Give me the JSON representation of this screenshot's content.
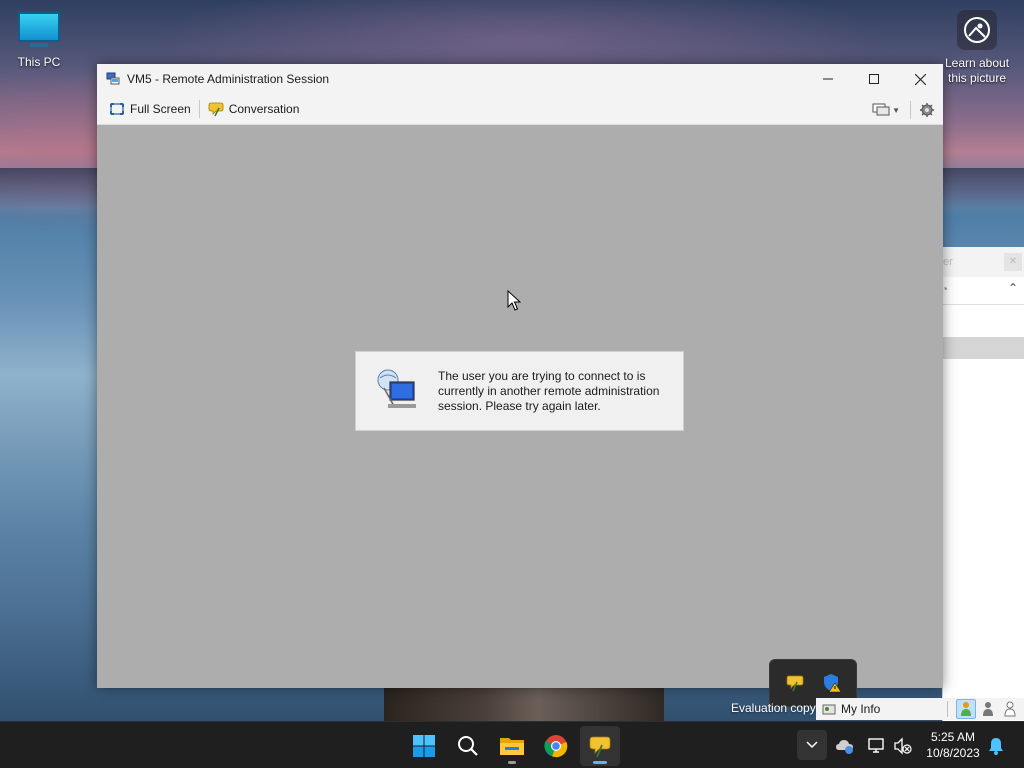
{
  "desktop": {
    "this_pc_label": "This PC",
    "learn_label": "Learn about this picture"
  },
  "window": {
    "title": "VM5 - Remote Administration Session",
    "controls": {
      "minimize": "minimize-icon",
      "maximize": "maximize-icon",
      "close": "close-icon"
    }
  },
  "toolbar": {
    "full_screen_label": "Full Screen",
    "conversation_label": "Conversation"
  },
  "dialog": {
    "message": "The user you are trying to connect to is currently in another remote administration session. Please try again later."
  },
  "background_window": {
    "fragment_text": "er"
  },
  "status_strip": {
    "evaluation_text": "Evaluation copy",
    "my_info_label": "My Info"
  },
  "taskbar": {
    "apps": [
      "start-icon",
      "search-icon",
      "file-explorer-icon",
      "chrome-icon",
      "chat-app-icon"
    ],
    "time": "5:25 AM",
    "date": "10/8/2023"
  },
  "colors": {
    "accent": "#0078d4",
    "session_background": "#adadad",
    "taskbar": "#1f1f1f"
  }
}
